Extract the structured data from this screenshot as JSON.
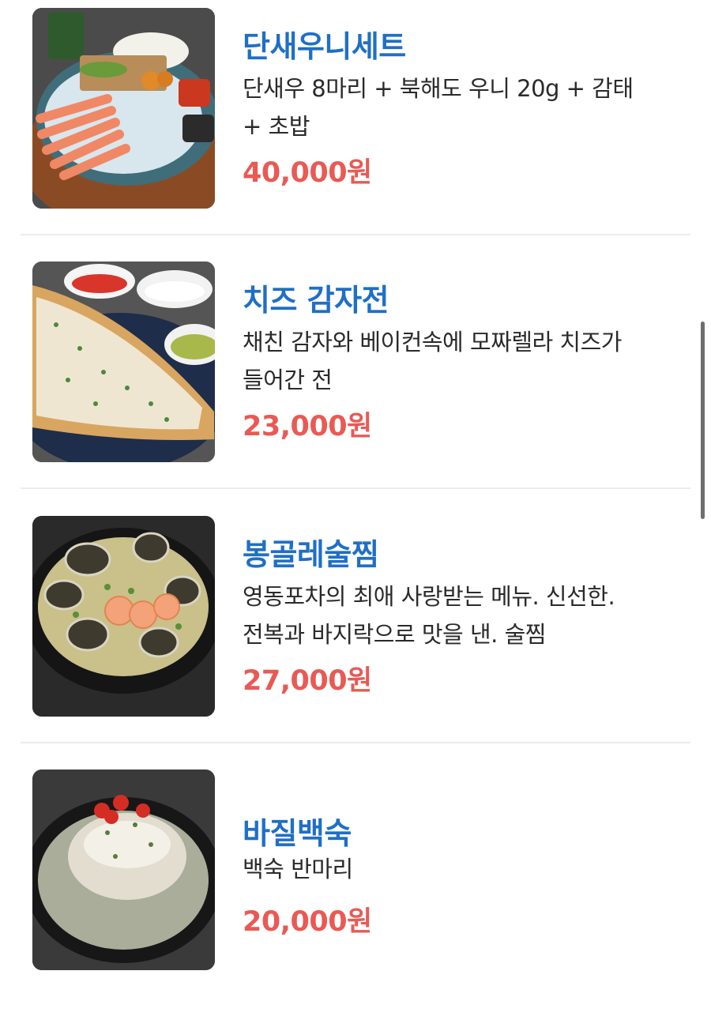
{
  "menu": {
    "items": [
      {
        "name": "단새우니세트",
        "desc_lines": [
          "단새우 8마리 + 북해도 우니 20g + 감태",
          "+ 초밥"
        ],
        "price": "40,000원",
        "image_icon": "shrimp-uni-set-photo"
      },
      {
        "name": "치즈 감자전",
        "desc_lines": [
          "채친 감자와 베이컨속에 모짜렐라 치즈가",
          "들어간 전"
        ],
        "price": "23,000원",
        "image_icon": "potato-pancake-photo"
      },
      {
        "name": "봉골레술찜",
        "desc_lines": [
          "영동포차의 최애 사랑받는 메뉴. 신선한.",
          "전복과 바지락으로 맛을 낸. 술찜"
        ],
        "price": "27,000원",
        "image_icon": "vongole-steamed-photo"
      },
      {
        "name": "바질백숙",
        "desc_lines": [
          "백숙 반마리"
        ],
        "price": "20,000원",
        "image_icon": "basil-baeksuk-photo"
      }
    ]
  },
  "colors": {
    "name": "#1f6fc5",
    "price": "#e85a54",
    "text": "#2a2a2a"
  }
}
